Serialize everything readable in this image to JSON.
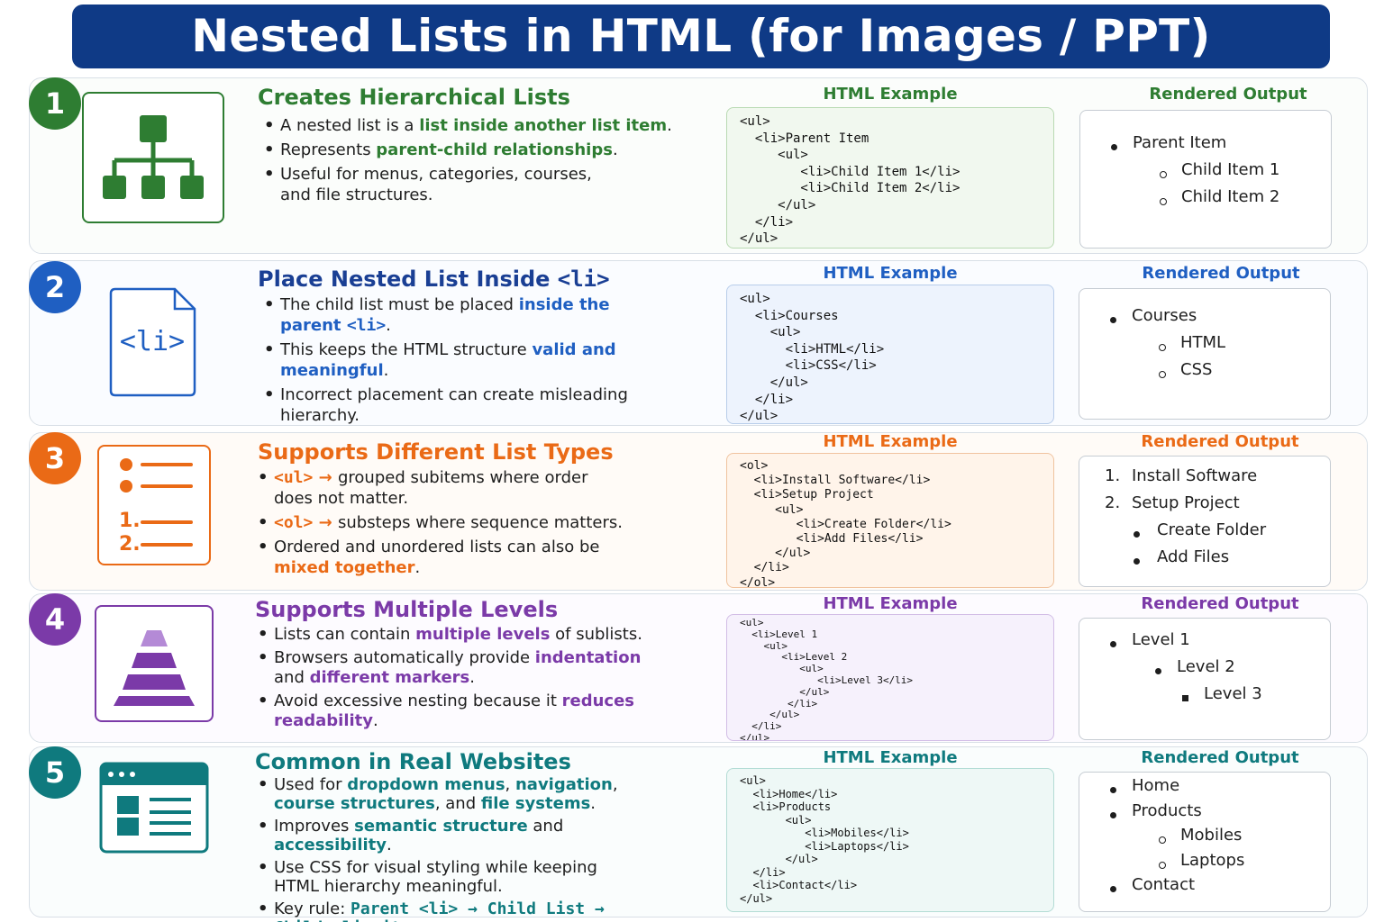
{
  "title": "Nested Lists in HTML (for Images / PPT)",
  "colors": {
    "title_bg": "#0f3a86",
    "s1": "#2e7d32",
    "s2": "#1f5fc2",
    "s3": "#ea6a16",
    "s4": "#7b3aa8",
    "s5": "#0f7a7e"
  },
  "labels": {
    "html_example": "HTML Example",
    "rendered_output": "Rendered Output"
  },
  "sections": [
    {
      "number": "1",
      "icon": "hierarchy-tree-icon",
      "heading": "Creates Hierarchical Lists",
      "bullets": [
        [
          {
            "t": "A nested list is a "
          },
          {
            "t": "list inside another list item",
            "h": true
          },
          {
            "t": "."
          }
        ],
        [
          {
            "t": "Represents "
          },
          {
            "t": "parent-child relationships",
            "h": true
          },
          {
            "t": "."
          }
        ],
        [
          {
            "t": "Useful for menus, categories, courses,"
          },
          {
            "br": true
          },
          {
            "t": "and file structures."
          }
        ]
      ],
      "code": [
        "<ul>",
        "  <li>Parent Item",
        "     <ul>",
        "        <li>Child Item 1</li>",
        "        <li>Child Item 2</li>",
        "     </ul>",
        "  </li>",
        "</ul>"
      ],
      "output": [
        {
          "text": "Parent Item",
          "level": 1,
          "marker": "disc"
        },
        {
          "text": "Child Item 1",
          "level": 2,
          "marker": "circle"
        },
        {
          "text": "Child Item 2",
          "level": 2,
          "marker": "circle"
        }
      ]
    },
    {
      "number": "2",
      "icon": "li-file-icon",
      "icon_text": "<li>",
      "heading": "Place Nested List Inside",
      "heading_code": "<li>",
      "bullets": [
        [
          {
            "t": "The child list must be placed "
          },
          {
            "t": "inside the",
            "h": true
          },
          {
            "br": true
          },
          {
            "t": "parent ",
            "h": true
          },
          {
            "t": "<li>",
            "h": true,
            "m": true
          },
          {
            "t": "."
          }
        ],
        [
          {
            "t": "This keeps the HTML structure "
          },
          {
            "t": "valid and",
            "h": true
          },
          {
            "br": true
          },
          {
            "t": "meaningful",
            "h": true
          },
          {
            "t": "."
          }
        ],
        [
          {
            "t": "Incorrect placement can create misleading"
          },
          {
            "br": true
          },
          {
            "t": "hierarchy."
          }
        ]
      ],
      "code": [
        "<ul>",
        "  <li>Courses",
        "    <ul>",
        "      <li>HTML</li>",
        "      <li>CSS</li>",
        "    </ul>",
        "  </li>",
        "</ul>"
      ],
      "output": [
        {
          "text": "Courses",
          "level": 1,
          "marker": "disc"
        },
        {
          "text": "HTML",
          "level": 2,
          "marker": "circle"
        },
        {
          "text": "CSS",
          "level": 2,
          "marker": "circle"
        }
      ]
    },
    {
      "number": "3",
      "icon": "list-types-icon",
      "icon_text": [
        "1.",
        "2."
      ],
      "heading": "Supports Different List Types",
      "bullets": [
        [
          {
            "t": "<ul>",
            "h": true,
            "m": true
          },
          {
            "t": " → ",
            "h": true
          },
          {
            "t": "grouped subitems where order"
          },
          {
            "br": true
          },
          {
            "t": "does not matter."
          }
        ],
        [
          {
            "t": "<ol>",
            "h": true,
            "m": true
          },
          {
            "t": " → ",
            "h": true
          },
          {
            "t": "substeps where sequence matters."
          }
        ],
        [
          {
            "t": "Ordered and unordered lists can also be"
          },
          {
            "br": true
          },
          {
            "t": "mixed together",
            "h": true
          },
          {
            "t": "."
          }
        ]
      ],
      "code": [
        "<ol>",
        "  <li>Install Software</li>",
        "  <li>Setup Project",
        "     <ul>",
        "        <li>Create Folder</li>",
        "        <li>Add Files</li>",
        "     </ul>",
        "  </li>",
        "</ol>"
      ],
      "output": [
        {
          "text": "Install Software",
          "level": 1,
          "marker": "1."
        },
        {
          "text": "Setup Project",
          "level": 1,
          "marker": "2."
        },
        {
          "text": "Create Folder",
          "level": 2,
          "marker": "disc"
        },
        {
          "text": "Add Files",
          "level": 2,
          "marker": "disc"
        }
      ]
    },
    {
      "number": "4",
      "icon": "pyramid-icon",
      "heading": "Supports Multiple Levels",
      "bullets": [
        [
          {
            "t": "Lists can contain "
          },
          {
            "t": "multiple levels",
            "h": true
          },
          {
            "t": " of sublists."
          }
        ],
        [
          {
            "t": "Browsers automatically provide "
          },
          {
            "t": "indentation",
            "h": true
          },
          {
            "br": true
          },
          {
            "t": "and "
          },
          {
            "t": "different markers",
            "h": true
          },
          {
            "t": "."
          }
        ],
        [
          {
            "t": "Avoid excessive nesting because it "
          },
          {
            "t": "reduces",
            "h": true
          },
          {
            "br": true
          },
          {
            "t": "readability",
            "h": true
          },
          {
            "t": "."
          }
        ]
      ],
      "code": [
        "<ul>",
        "  <li>Level 1",
        "    <ul>",
        "       <li>Level 2",
        "          <ul>",
        "             <li>Level 3</li>",
        "          </ul>",
        "        </li>",
        "     </ul>",
        "  </li>",
        "</ul>"
      ],
      "output": [
        {
          "text": "Level 1",
          "level": 1,
          "marker": "disc"
        },
        {
          "text": "Level 2",
          "level": 2,
          "marker": "disc"
        },
        {
          "text": "Level 3",
          "level": 3,
          "marker": "square"
        }
      ]
    },
    {
      "number": "5",
      "icon": "website-layout-icon",
      "heading": "Common in Real Websites",
      "bullets": [
        [
          {
            "t": "Used for "
          },
          {
            "t": "dropdown menus",
            "h": true
          },
          {
            "t": ", "
          },
          {
            "t": "navigation",
            "h": true
          },
          {
            "t": ","
          },
          {
            "br": true
          },
          {
            "t": "course structures",
            "h": true
          },
          {
            "t": ", and "
          },
          {
            "t": "file systems",
            "h": true
          },
          {
            "t": "."
          }
        ],
        [
          {
            "t": "Improves "
          },
          {
            "t": "semantic structure",
            "h": true
          },
          {
            "t": " and "
          },
          {
            "t": "accessibility",
            "h": true
          },
          {
            "t": "."
          }
        ],
        [
          {
            "t": "Use CSS for visual styling while keeping"
          },
          {
            "br": true
          },
          {
            "t": "HTML hierarchy meaningful."
          }
        ],
        [
          {
            "t": "Key rule: "
          },
          {
            "t": "Parent <li> → Child List →",
            "h": true,
            "m": true
          },
          {
            "br": true
          },
          {
            "t": "Child <li> items",
            "h": true,
            "m": true
          },
          {
            "t": "."
          }
        ]
      ],
      "code": [
        "<ul>",
        "  <li>Home</li>",
        "  <li>Products",
        "       <ul>",
        "          <li>Mobiles</li>",
        "          <li>Laptops</li>",
        "       </ul>",
        "  </li>",
        "  <li>Contact</li>",
        "</ul>"
      ],
      "output": [
        {
          "text": "Home",
          "level": 1,
          "marker": "disc"
        },
        {
          "text": "Products",
          "level": 1,
          "marker": "disc"
        },
        {
          "text": "Mobiles",
          "level": 2,
          "marker": "circle"
        },
        {
          "text": "Laptops",
          "level": 2,
          "marker": "circle"
        },
        {
          "text": "Contact",
          "level": 1,
          "marker": "disc"
        }
      ]
    }
  ]
}
